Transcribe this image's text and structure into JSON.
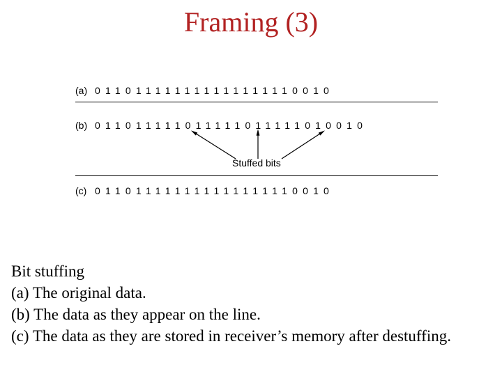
{
  "title": "Framing (3)",
  "figure": {
    "label_a": "(a)",
    "label_b": "(b)",
    "label_c": "(c)",
    "bits_a": "011011111111111111110010",
    "bits_b": "011011111011111011111010010",
    "bits_c": "011011111111111111110010",
    "stuffed_label": "Stuffed bits"
  },
  "caption": {
    "intro": "Bit stuffing",
    "a": "(a) The original data.",
    "b": "(b) The data as they appear on the line.",
    "c": "(c) The data as they are stored in receiver’s memory after destuffing."
  }
}
